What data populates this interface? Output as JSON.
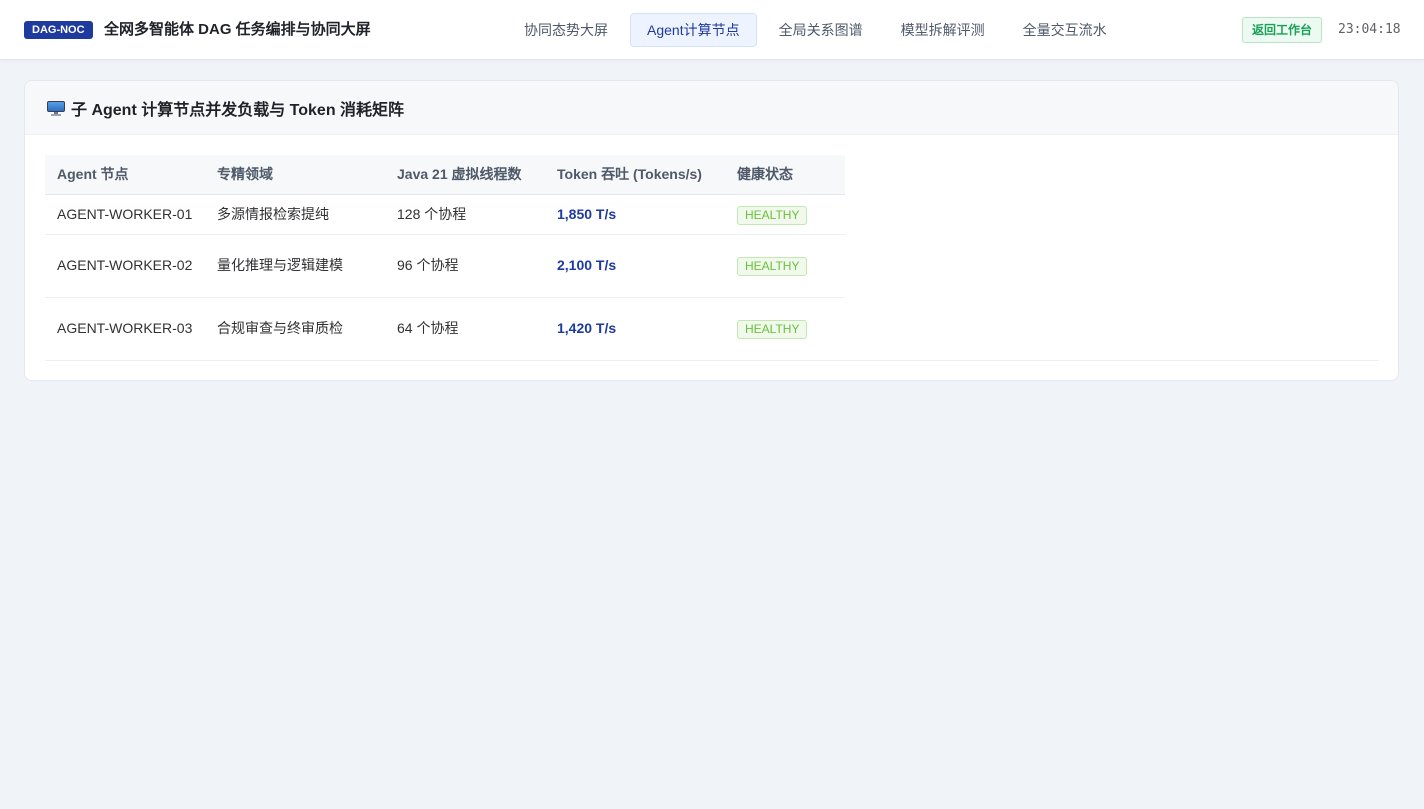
{
  "header": {
    "brand_badge": "DAG-NOC",
    "title": "全网多智能体 DAG 任务编排与协同大屏",
    "tabs": [
      {
        "label": "协同态势大屏",
        "active": false
      },
      {
        "label": "Agent计算节点",
        "active": true
      },
      {
        "label": "全局关系图谱",
        "active": false
      },
      {
        "label": "模型拆解评测",
        "active": false
      },
      {
        "label": "全量交互流水",
        "active": false
      }
    ],
    "back_button": "返回工作台",
    "clock": "23:04:18"
  },
  "card": {
    "icon": "desktop-computer-icon",
    "title": "子 Agent 计算节点并发负载与 Token 消耗矩阵"
  },
  "table": {
    "columns": [
      "Agent 节点",
      "专精领域",
      "Java 21 虚拟线程数",
      "Token 吞吐 (Tokens/s)",
      "健康状态"
    ],
    "rows": [
      {
        "node": "AGENT-WORKER-01",
        "domain": "多源情报检索提纯",
        "threads": "128 个协程",
        "tokens": "1,850 T/s",
        "status": "HEALTHY"
      },
      {
        "node": "AGENT-WORKER-02",
        "domain": "量化推理与逻辑建模",
        "threads": "96 个协程",
        "tokens": "2,100 T/s",
        "status": "HEALTHY"
      },
      {
        "node": "AGENT-WORKER-03",
        "domain": "合规审查与终审质检",
        "threads": "64 个协程",
        "tokens": "1,420 T/s",
        "status": "HEALTHY"
      }
    ]
  },
  "colors": {
    "brand": "#1e3a9e",
    "healthy": "#67c23a",
    "back_button": "#18a058",
    "page_bg": "#f0f3f8"
  }
}
